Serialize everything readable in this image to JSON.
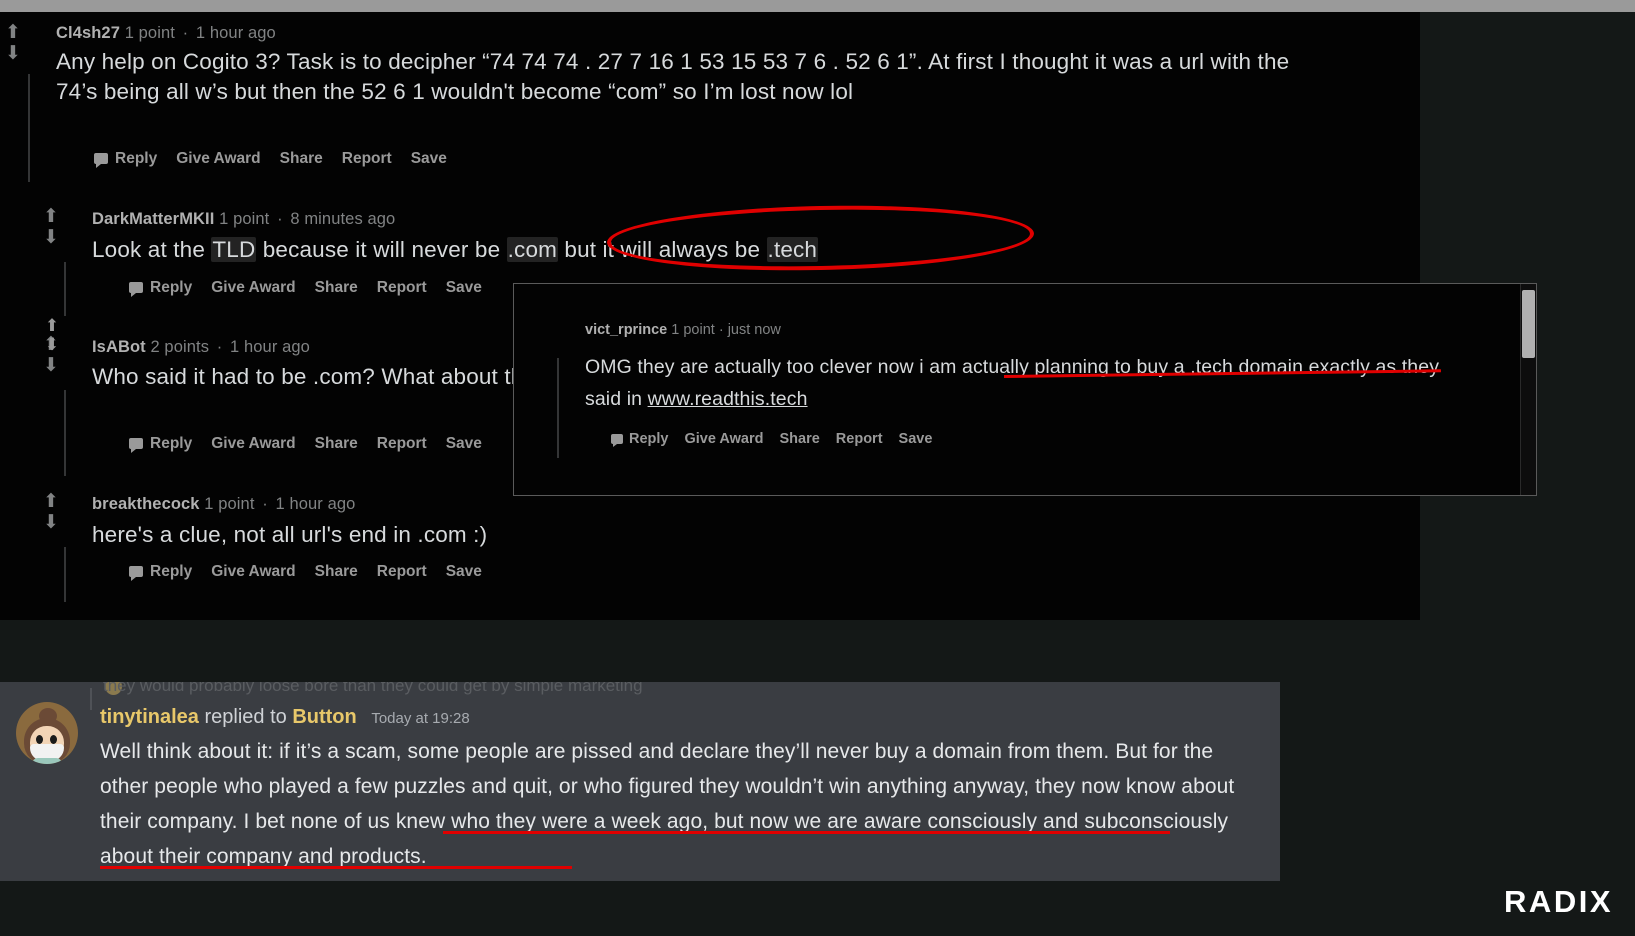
{
  "reddit": {
    "comments": [
      {
        "user": "Cl4sh27",
        "points": "1 point",
        "time": "1 hour ago",
        "body": "Any help on Cogito 3? Task is to decipher “74 74 74 . 27 7 16 1 53 15 53 7 6 . 52 6 1”. At first I thought it was a url with the 74’s being all w’s but then the 52 6 1 wouldn't become “com” so I’m lost now lol"
      },
      {
        "user": "DarkMatterMKII",
        "points": "1 point",
        "time": "8 minutes ago",
        "body_pre": "Look at the ",
        "body_hl1": "TLD",
        "body_mid1": " because it will never be ",
        "body_hl2": ".com",
        "body_mid2": " but it will always be ",
        "body_hl3": ".tech"
      },
      {
        "user": "IsABot",
        "points": "2 points",
        "time": "1 hour ago",
        "body": "Who said it had to be .com? What about the rest of the contest?"
      },
      {
        "user": "breakthecock",
        "points": "1 point",
        "time": "1 hour ago",
        "body": "here's a clue, not all url's end in .com :)"
      }
    ],
    "actions": [
      "Reply",
      "Give Award",
      "Share",
      "Report",
      "Save"
    ],
    "separator": "·",
    "upvote_glyph": "⬆",
    "downvote_glyph": "⬇"
  },
  "overlay": {
    "user": "vict_rprince",
    "points": "1 point",
    "time": "just now",
    "separator": "·",
    "body_pre": "OMG they are actually too clever now i am actually planning to buy a .tech domain exactly as they said in ",
    "link": "www.readthis.tech",
    "actions": [
      "Reply",
      "Give Award",
      "Share",
      "Report",
      "Save"
    ]
  },
  "discord": {
    "previous_line": "they would probably loose bore than they could get by simple marketing",
    "user": "tinytinalea",
    "replied_to_label": "replied to",
    "target_user": "Button",
    "timestamp": "Today at 19:28",
    "message": "Well think about it: if it’s a scam, some people are pissed and declare they’ll never buy a domain from them. But for the other people who played a few puzzles and quit, or who figured they wouldn’t win anything anyway, they now know about their company. I bet none of us knew who they were a week ago, but now we are aware consciously and subconsciously about their company and products."
  },
  "branding": {
    "logo": "RADIX"
  },
  "annotations": {
    "ellipse_color": "#e00000",
    "underline_color": "#e00000"
  }
}
